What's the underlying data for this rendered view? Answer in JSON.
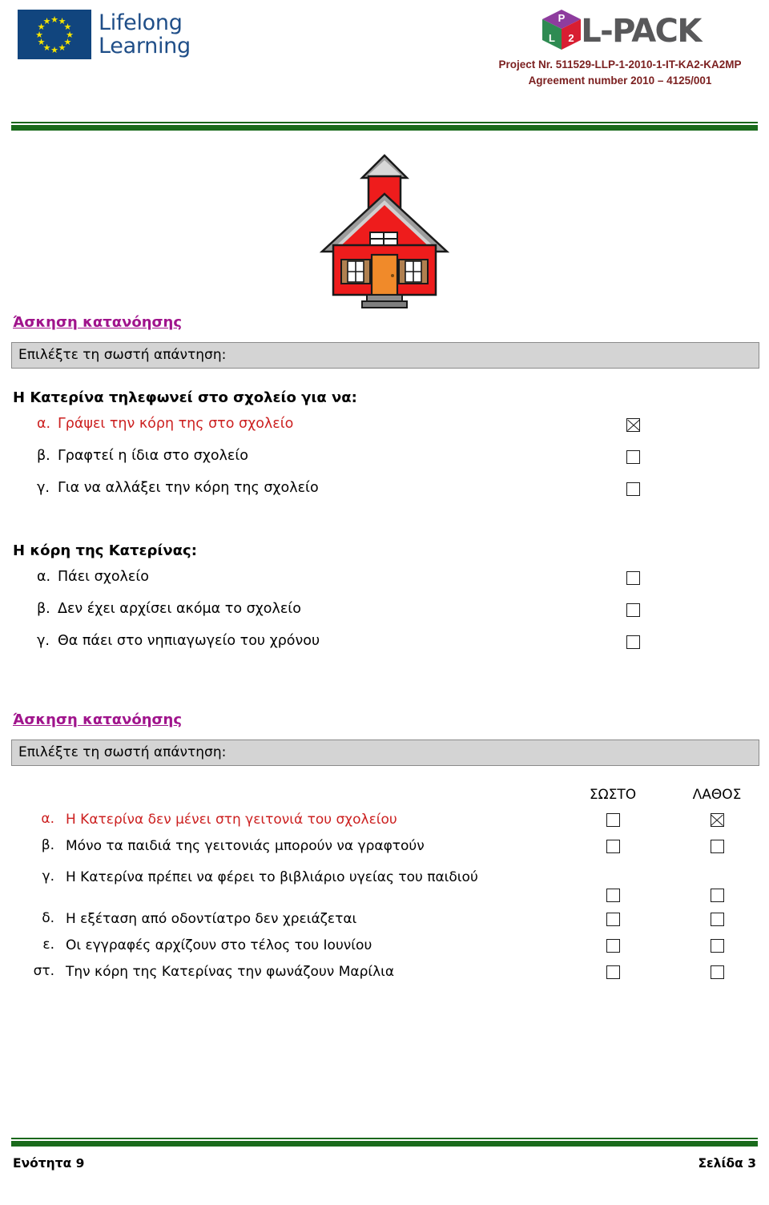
{
  "header": {
    "eu_logo_line1": "Lifelong",
    "eu_logo_line2": "Learning",
    "lpack_name": "L-PACK",
    "cube_face_top": "P",
    "cube_face_left": "L",
    "cube_face_right": "2",
    "project_number": "Project Nr. 511529-LLP-1-2010-1-IT-KA2-KA2MP",
    "agreement_number": "Agreement number 2010 – 4125/001"
  },
  "illustration": {
    "name": "schoolhouse-clipart",
    "colors": {
      "wall": "#EE1C1C",
      "roof": "#8E8E8E",
      "door": "#F08A2A",
      "window_frame": "#B08050",
      "outline": "#1a1a1a"
    }
  },
  "section1": {
    "heading": "Άσκηση κατανόησης",
    "instruction": "Επιλέξτε τη σωστή απάντηση:",
    "question1": {
      "stem": "Η Κατερίνα τηλεφωνεί στο σχολείο για να:",
      "options": [
        {
          "letter": "α.",
          "text": "Γράψει την κόρη της στο σχολείο",
          "checked": true,
          "highlighted": true
        },
        {
          "letter": "β.",
          "text": "Γραφτεί η ίδια στο σχολείο",
          "checked": false,
          "highlighted": false
        },
        {
          "letter": "γ.",
          "text": "Για να αλλάξει την κόρη της σχολείο",
          "checked": false,
          "highlighted": false
        }
      ]
    },
    "question2": {
      "stem": "Η κόρη της Κατερίνας:",
      "options": [
        {
          "letter": "α.",
          "text": "Πάει σχολείο",
          "checked": false,
          "highlighted": false
        },
        {
          "letter": "β.",
          "text": "Δεν έχει αρχίσει ακόμα το σχολείο",
          "checked": false,
          "highlighted": false
        },
        {
          "letter": "γ.",
          "text": "Θα πάει στο νηπιαγωγείο του χρόνου",
          "checked": false,
          "highlighted": false
        }
      ]
    }
  },
  "section2": {
    "heading": "Άσκηση κατανόησης",
    "instruction": "Επιλέξτε τη σωστή απάντηση:",
    "column_true": "ΣΩΣΤΟ",
    "column_false": "ΛΑΘΟΣ",
    "rows": [
      {
        "letter": "α.",
        "text": "Η Κατερίνα δεν μένει στη γειτονιά του σχολείου",
        "true_checked": false,
        "false_checked": true,
        "highlighted": true
      },
      {
        "letter": "β.",
        "text": "Μόνο τα παιδιά της γειτονιάς μπορούν να γραφτούν",
        "true_checked": false,
        "false_checked": false,
        "highlighted": false
      },
      {
        "letter": "γ.",
        "text": "Η Κατερίνα πρέπει να φέρει το βιβλιάριο υγείας του παιδιού",
        "true_checked": false,
        "false_checked": false,
        "highlighted": false,
        "two_line": true
      },
      {
        "letter": "δ.",
        "text": "Η εξέταση από οδοντίατρο δεν χρειάζεται",
        "true_checked": false,
        "false_checked": false,
        "highlighted": false
      },
      {
        "letter": "ε.",
        "text": "Οι εγγραφές αρχίζουν στο τέλος του Ιουνίου",
        "true_checked": false,
        "false_checked": false,
        "highlighted": false
      },
      {
        "letter": "στ.",
        "text": "Την κόρη της Κατερίνας την φωνάζουν Μαρίλια",
        "true_checked": false,
        "false_checked": false,
        "highlighted": false
      }
    ]
  },
  "footer": {
    "left": "Ενότητα 9",
    "right": "Σελίδα 3"
  },
  "colors": {
    "heading_purple": "#A0148C",
    "answer_red": "#CC2020",
    "rule_green": "#1A6B1C",
    "project_text": "#7B1F1F",
    "instruction_bar": "#D4D4D4"
  }
}
